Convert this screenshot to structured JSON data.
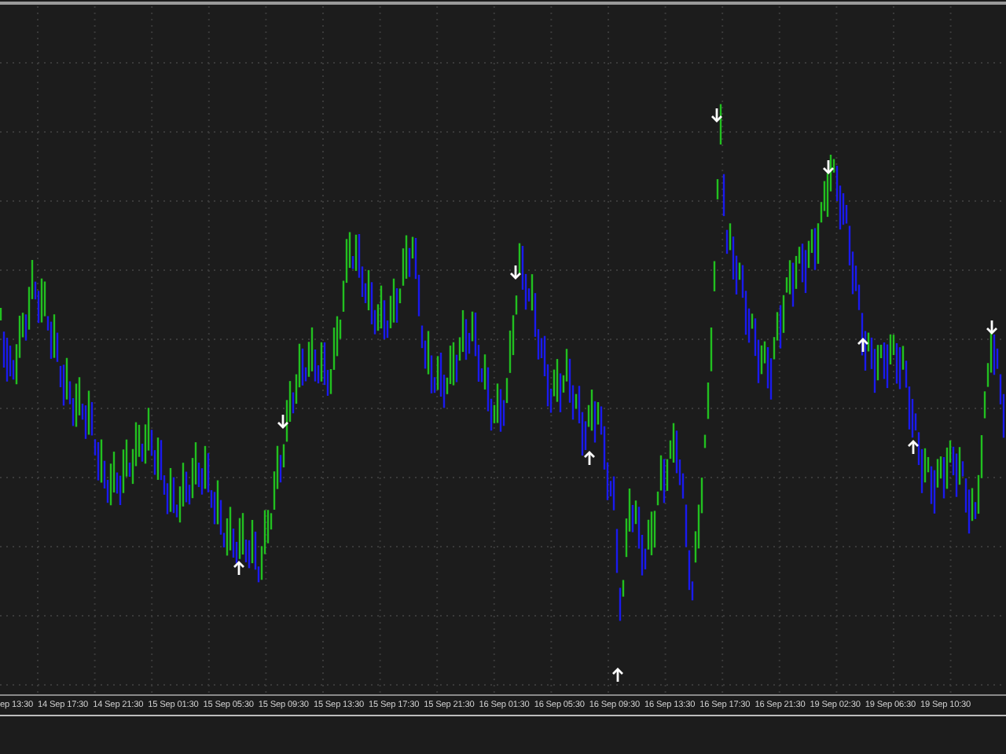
{
  "chart": {
    "time_labels": [
      "ep 13:30",
      "14 Sep 17:30",
      "14 Sep 21:30",
      "15 Sep 01:30",
      "15 Sep 05:30",
      "15 Sep 09:30",
      "15 Sep 13:30",
      "15 Sep 17:30",
      "15 Sep 21:30",
      "16 Sep 01:30",
      "16 Sep 05:30",
      "16 Sep 09:30",
      "16 Sep 13:30",
      "16 Sep 17:30",
      "16 Sep 21:30",
      "19 Sep 02:30",
      "19 Sep 06:30",
      "19 Sep 10:30"
    ]
  }
}
